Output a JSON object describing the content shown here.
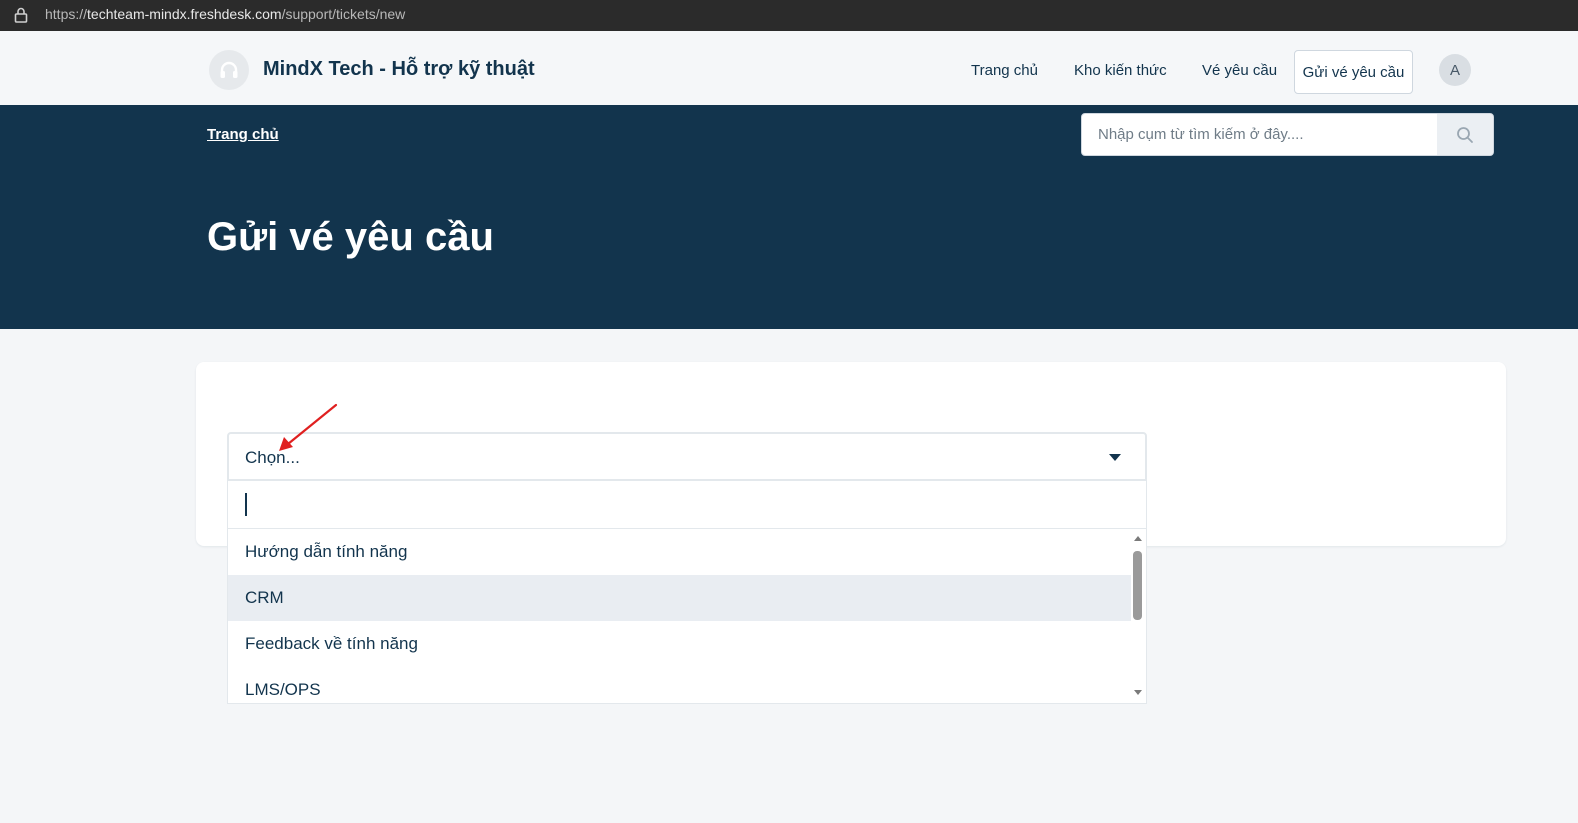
{
  "browser": {
    "url_scheme": "https://",
    "url_domain": "techteam-mindx.freshdesk.com",
    "url_path": "/support/tickets/new"
  },
  "header": {
    "brand": "MindX Tech - Hỗ trợ kỹ thuật",
    "nav": [
      "Trang chủ",
      "Kho kiến thức",
      "Vé yêu cầu"
    ],
    "cta": "Gửi vé yêu cầu",
    "avatar_initial": "A"
  },
  "hero": {
    "breadcrumb": "Trang chủ",
    "search_placeholder": "Nhập cụm từ tìm kiếm ở đây....",
    "title": "Gửi vé yêu cầu"
  },
  "form": {
    "select_value": "Chọn...",
    "options": [
      "Hướng dẫn tính năng",
      "CRM",
      "Feedback về tính năng",
      "LMS/OPS"
    ],
    "highlighted_option": "CRM"
  },
  "colors": {
    "hero_bg": "#12344d",
    "text": "#12344d",
    "annotation_arrow": "#e02020"
  },
  "icons": {
    "lock": "lock-icon",
    "logo": "headset-icon",
    "search": "search-icon",
    "caret": "caret-down-icon"
  }
}
